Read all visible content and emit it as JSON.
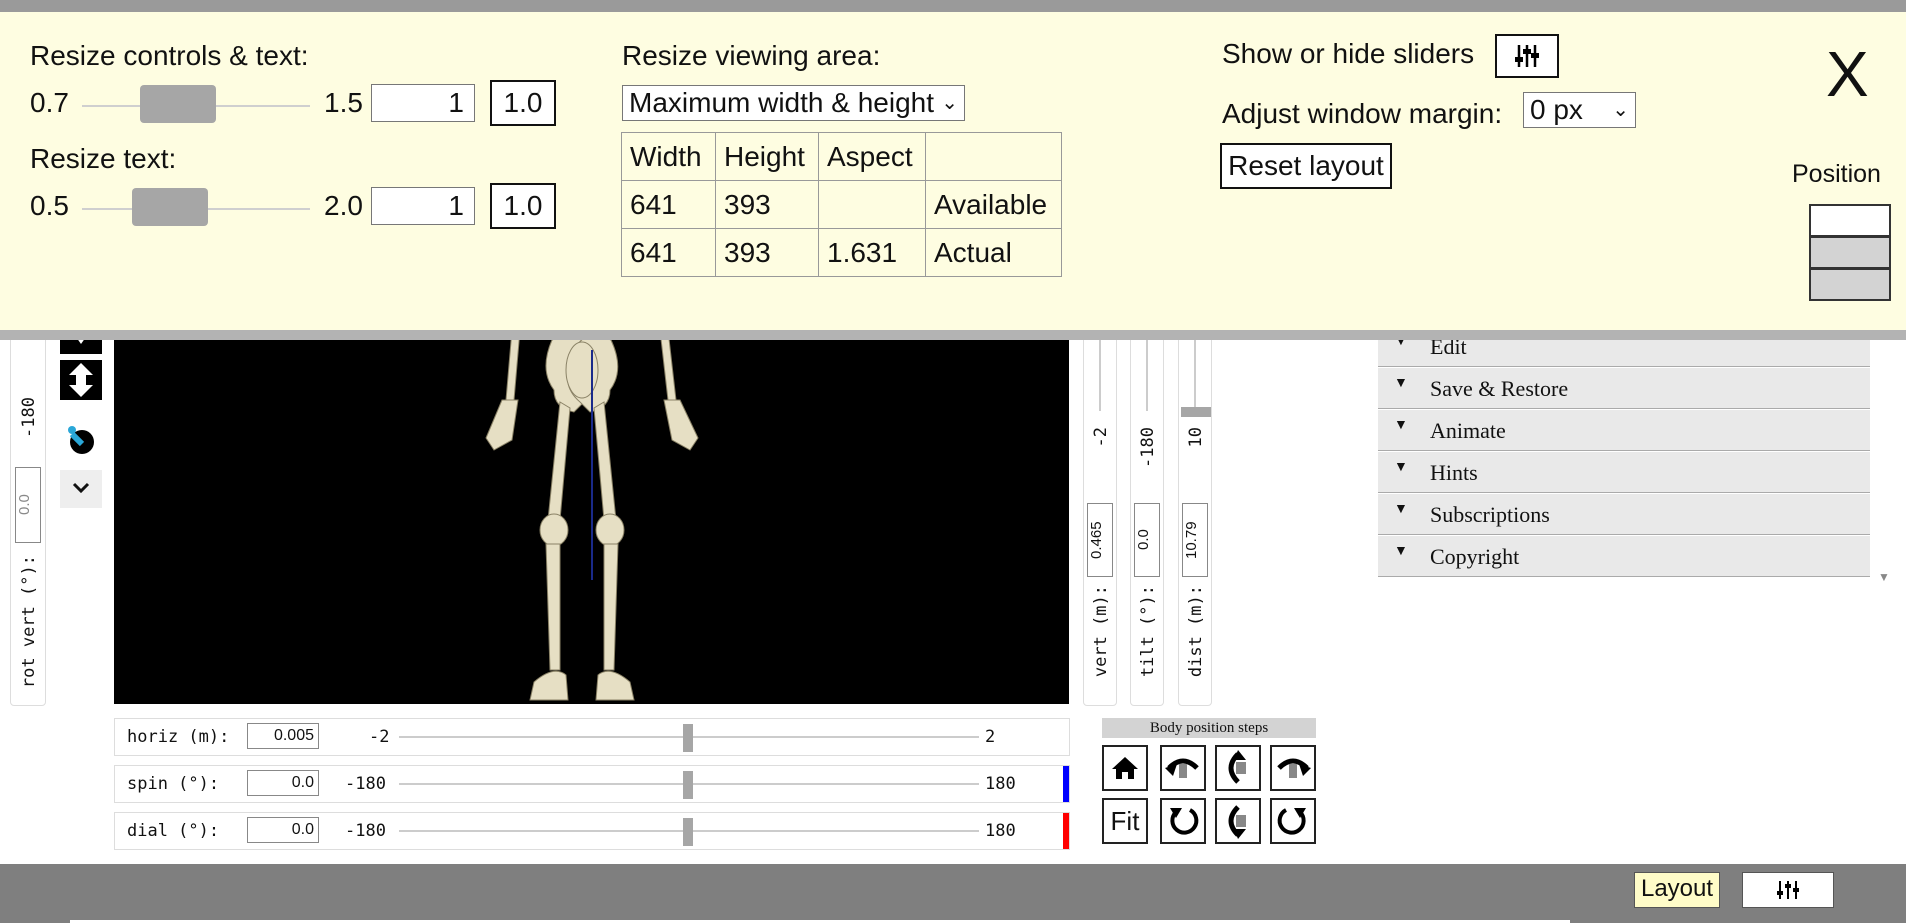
{
  "layout_panel": {
    "resize_controls_label": "Resize controls & text:",
    "controls_min": "0.7",
    "controls_max": "1.5",
    "controls_value": "1",
    "controls_reset": "1.0",
    "resize_text_label": "Resize text:",
    "text_min": "0.5",
    "text_max": "2.0",
    "text_value": "1",
    "text_reset": "1.0",
    "viewing_area_label": "Resize viewing area:",
    "viewing_area_select": "Maximum width & height",
    "table": {
      "headers": [
        "Width",
        "Height",
        "Aspect",
        ""
      ],
      "rows": [
        [
          "641",
          "393",
          "",
          "Available"
        ],
        [
          "641",
          "393",
          "1.631",
          "Actual"
        ]
      ]
    },
    "show_hide_sliders_label": "Show or hide sliders",
    "window_margin_label": "Adjust window margin:",
    "window_margin_value": "0 px",
    "reset_layout": "Reset layout",
    "close": "X",
    "position_label": "Position"
  },
  "left_slider": {
    "label": "rot vert (°):",
    "value": "0.0",
    "max": "-180"
  },
  "right_sliders": [
    {
      "label": "vert  (m):",
      "value": "0.465",
      "max": "-2"
    },
    {
      "label": "tilt  (°):",
      "value": "0.0",
      "max": "-180"
    },
    {
      "label": "dist  (m):",
      "value": "10.79",
      "max": "10"
    }
  ],
  "bottom_sliders": [
    {
      "label": "horiz (m):",
      "value": "0.005",
      "min": "-2",
      "max": "2"
    },
    {
      "label": "spin  (°):",
      "value": "0.0",
      "min": "-180",
      "max": "180"
    },
    {
      "label": "dial  (°):",
      "value": "0.0",
      "min": "-180",
      "max": "180"
    }
  ],
  "body_steps": {
    "title": "Body position steps",
    "fit": "Fit"
  },
  "accordion": [
    "Edit",
    "Save & Restore",
    "Animate",
    "Hints",
    "Subscriptions",
    "Copyright"
  ],
  "footer": {
    "layout_button": "Layout"
  },
  "colors": {
    "panel_bg": "#fefde1",
    "spin_marker": "#0000ff",
    "dial_marker": "#ff0000",
    "footer_bg": "#7f7f7f",
    "layout_button_bg": "#fffcc8"
  },
  "icons": {
    "sliders": "sliders-icon",
    "home": "home-icon",
    "rotate_left": "rotate-left-icon",
    "rotate_right": "rotate-right-icon"
  }
}
